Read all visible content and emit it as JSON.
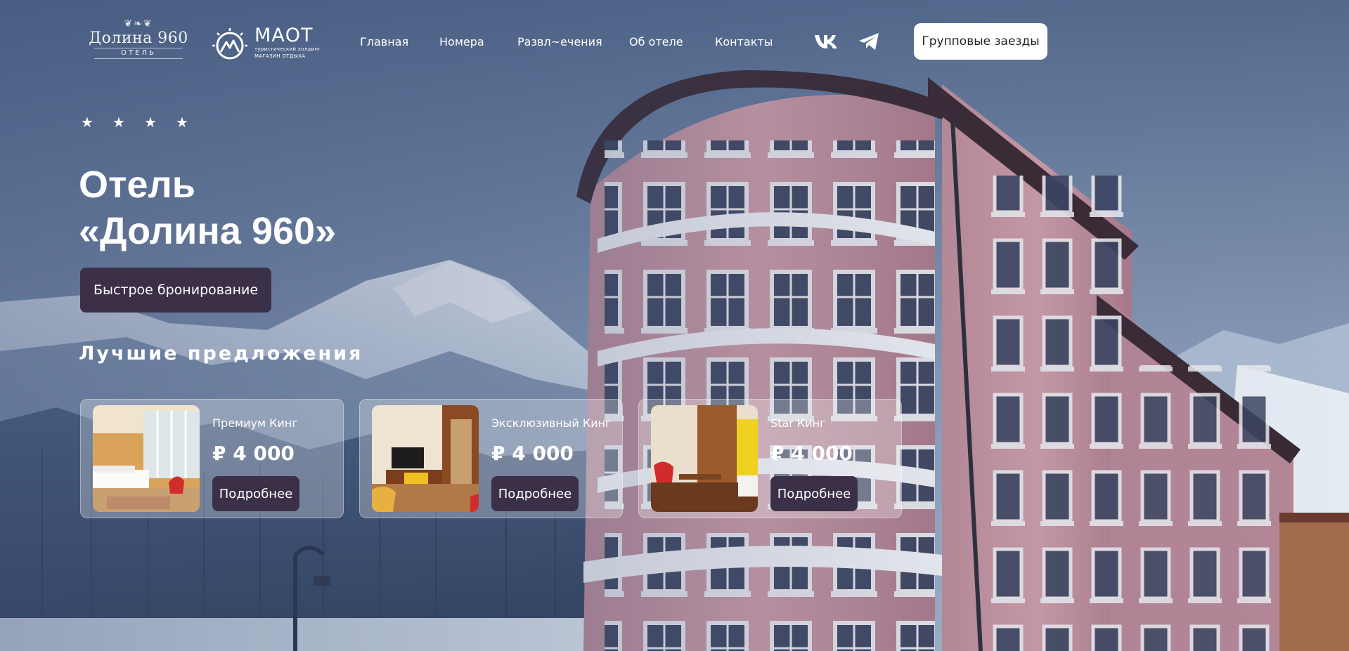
{
  "brand": {
    "hotel_logo": {
      "name": "Долина 960",
      "sub": "ОТЕЛЬ"
    },
    "maot_logo": {
      "title": "МАОТ",
      "line1": "туристический холдинг",
      "line2": "МАГАЗИН ОТДЫХА"
    }
  },
  "nav": {
    "items": [
      {
        "label": "Главная"
      },
      {
        "label": "Номера"
      },
      {
        "label": "Развл~ечения"
      },
      {
        "label": "Об отеле"
      },
      {
        "label": "Контакты"
      }
    ]
  },
  "social": {
    "vk_icon": "vk-icon",
    "telegram_icon": "telegram-icon"
  },
  "header": {
    "group_button": "Групповые заезды"
  },
  "hero": {
    "stars": [
      "★",
      "★",
      "★",
      "★"
    ],
    "title_line1": "Отель",
    "title_line2": "«Долина 960»",
    "book_button": "Быстрое бронирование",
    "offers_title": "Лучшие предложения"
  },
  "offers": [
    {
      "name": "Премиум Кинг",
      "price": "₽ 4 000",
      "button": "Подробнее"
    },
    {
      "name": "Эксклюзивный Кинг",
      "price": "₽ 4 000",
      "button": "Подробнее"
    },
    {
      "name": "Star Кинг",
      "price": "₽ 4 000",
      "button": "Подробнее"
    }
  ],
  "colors": {
    "accent_dark": "#3c3049",
    "white": "#ffffff",
    "sky": "#5d7393"
  }
}
